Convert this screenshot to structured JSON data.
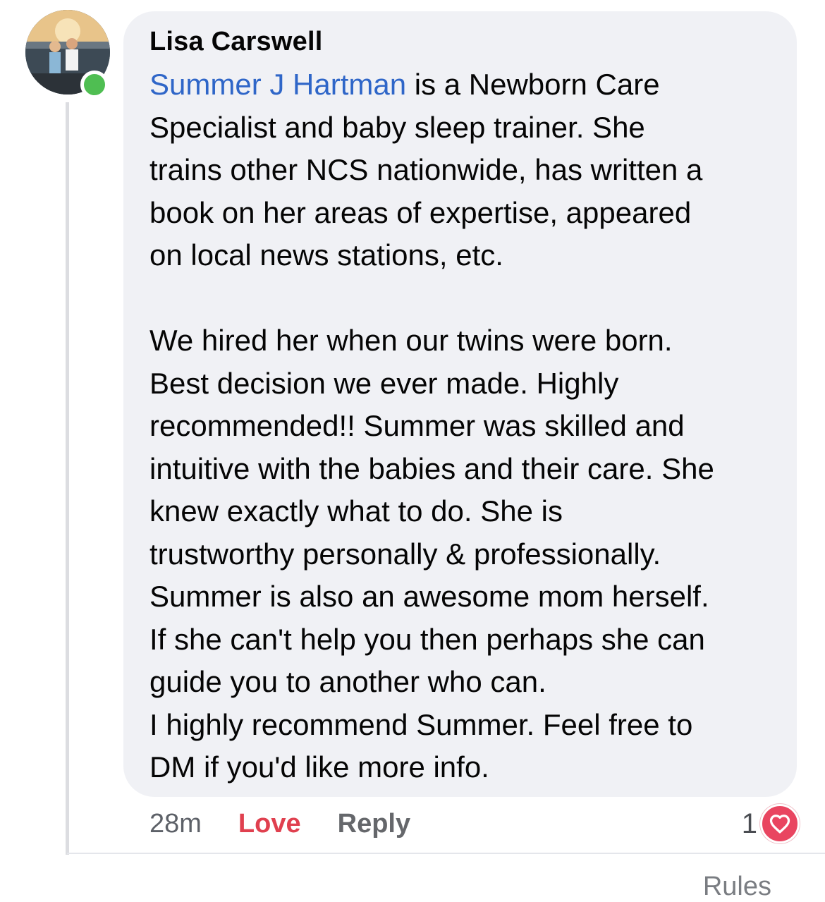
{
  "comment": {
    "author": "Lisa Carswell",
    "mention": "Summer J Hartman",
    "paragraph1_rest_line1": " is a Newborn Care",
    "paragraph1_lines": [
      "Specialist and baby sleep trainer. She",
      "trains other NCS nationwide, has written a",
      "book on her areas of expertise, appeared",
      "on local news stations, etc."
    ],
    "paragraph2_lines": [
      "We hired her when our twins were born.",
      "Best decision we ever made. Highly",
      "recommended!! Summer was skilled and",
      "intuitive with the babies and their care. She",
      "knew exactly what to do. She is",
      "trustworthy personally & professionally.",
      "Summer is also an awesome mom herself.",
      "If she can't help you then perhaps she can",
      "guide you to another who can.",
      "I highly recommend Summer. Feel free to",
      "DM if you'd like more info."
    ]
  },
  "actions": {
    "time": "28m",
    "love_label": "Love",
    "reply_label": "Reply"
  },
  "reactions": {
    "count": "1",
    "icon": "heart-icon"
  },
  "footer": {
    "rules_label": "Rules"
  },
  "colors": {
    "mention": "#2f66c8",
    "love": "#e0404f",
    "online": "#4fbe52",
    "bubble": "#f0f1f5"
  }
}
